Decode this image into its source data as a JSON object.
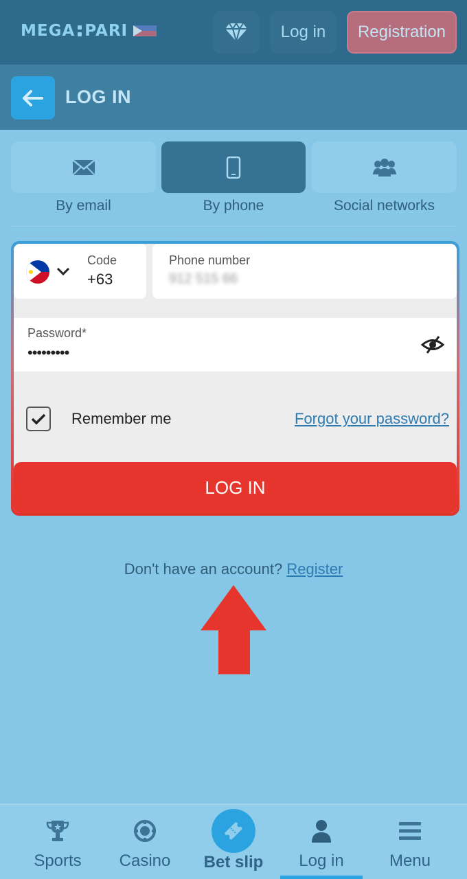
{
  "header": {
    "logo_left": "MEGA",
    "logo_right": "PARI",
    "login_label": "Log in",
    "registration_label": "Registration"
  },
  "titlebar": {
    "title": "LOG IN"
  },
  "tabs": [
    {
      "label": "By email",
      "icon": "envelope-icon",
      "active": false
    },
    {
      "label": "By phone",
      "icon": "phone-icon",
      "active": true
    },
    {
      "label": "Social networks",
      "icon": "users-icon",
      "active": false
    }
  ],
  "form": {
    "code_label": "Code",
    "code_value": "+63",
    "phone_label": "Phone number",
    "phone_value": "912 515 66",
    "password_label": "Password*",
    "password_value": "•••••••••",
    "remember_label": "Remember me",
    "remember_checked": true,
    "forgot_label": "Forgot your password?",
    "submit_label": "LOG IN"
  },
  "register_prompt": {
    "text": "Don't have an account?",
    "link": "Register"
  },
  "bottom_nav": [
    {
      "label": "Sports",
      "icon": "trophy-icon"
    },
    {
      "label": "Casino",
      "icon": "casino-chip-icon"
    },
    {
      "label": "Bet slip",
      "icon": "ticket-icon"
    },
    {
      "label": "Log in",
      "icon": "user-icon",
      "active": true
    },
    {
      "label": "Menu",
      "icon": "hamburger-icon"
    }
  ],
  "colors": {
    "header_bg": "#2d6a8b",
    "page_bg": "#86c6e6",
    "accent_blue": "#2aa3e0",
    "login_red": "#e6352c",
    "registration_btn": "#b66e7d"
  }
}
